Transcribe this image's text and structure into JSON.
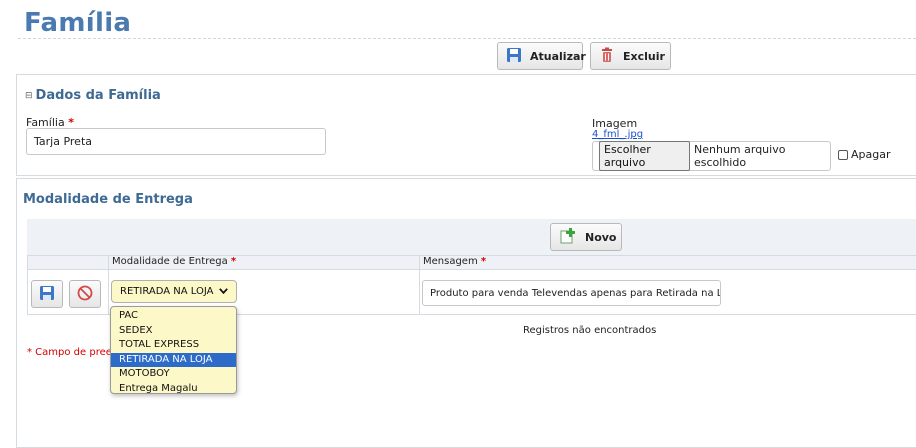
{
  "page": {
    "title": "Família"
  },
  "toolbar": {
    "update_label": "Atualizar",
    "delete_label": "Excluir"
  },
  "dados": {
    "title": "Dados da Família",
    "collapse_icon": "⊟",
    "familia_label": "Família",
    "familia_value": "Tarja Preta",
    "imagem_label": "Imagem",
    "imagem_link": "4_fml_.jpg",
    "file_button": "Escolher arquivo",
    "file_status": "Nenhum arquivo escolhido",
    "apagar_label": "Apagar"
  },
  "modalidade": {
    "title": "Modalidade de Entrega",
    "new_button": "Novo",
    "headers": [
      "Modalidade de Entrega",
      "Mensagem"
    ],
    "required_mark": "*",
    "row": {
      "selected": "RETIRADA NA LOJA",
      "mensagem": "Produto para venda Televendas apenas para Retirada na Lo"
    },
    "options": [
      "PAC",
      "SEDEX",
      "TOTAL EXPRESS",
      "RETIRADA NA LOJA",
      "MOTOBOY",
      "Entrega Magalu"
    ],
    "empty_message": "Registros não encontrados",
    "footnote": "* Campo de pree"
  },
  "colors": {
    "title": "#4a7ab0",
    "section": "#3e6a94",
    "selected_option": "#2d6bc9",
    "select_bg": "#fdf8c8",
    "required": "#d40000"
  }
}
